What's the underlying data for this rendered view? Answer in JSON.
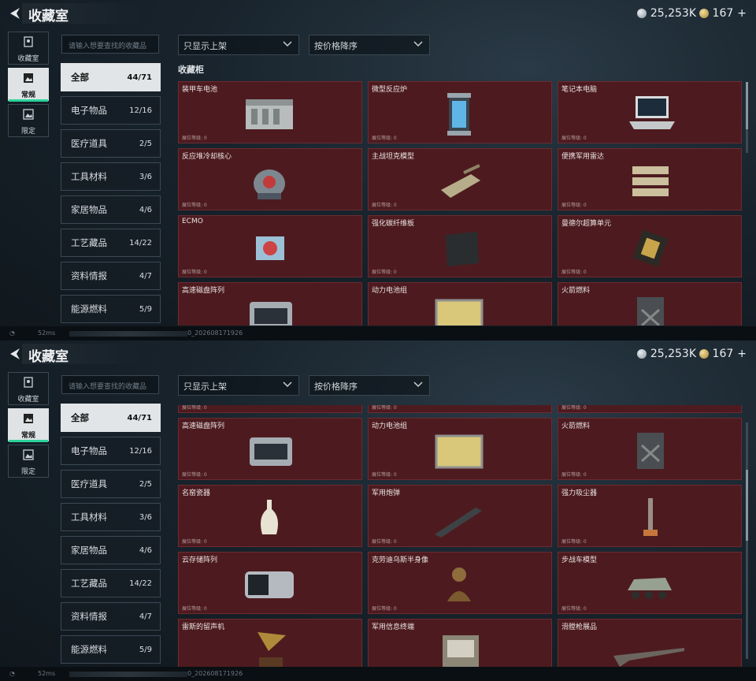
{
  "header": {
    "title": "收藏室",
    "currency1": "25,253K",
    "currency2": "167",
    "plus": "+"
  },
  "nav": [
    {
      "label": "收藏室",
      "icon": "portrait-icon"
    },
    {
      "label": "常规",
      "icon": "image-icon"
    },
    {
      "label": "限定",
      "icon": "image-frame-icon"
    }
  ],
  "search": {
    "placeholder": "请输入想要查找的收藏品"
  },
  "filters": {
    "listing": "只显示上架",
    "sort": "按价格降序"
  },
  "categories": [
    {
      "label": "全部",
      "count": "44/71"
    },
    {
      "label": "电子物品",
      "count": "12/16"
    },
    {
      "label": "医疗道具",
      "count": "2/5"
    },
    {
      "label": "工具材料",
      "count": "3/6"
    },
    {
      "label": "家居物品",
      "count": "4/6"
    },
    {
      "label": "工艺藏品",
      "count": "14/22"
    },
    {
      "label": "资料情报",
      "count": "4/7"
    },
    {
      "label": "能源燃料",
      "count": "5/9"
    }
  ],
  "section_title": "收藏柜",
  "level_label": "展位等级: 0",
  "items_top": [
    {
      "name": "装甲车电池",
      "icon": "battery-icon"
    },
    {
      "name": "微型反应炉",
      "icon": "reactor-icon"
    },
    {
      "name": "笔记本电脑",
      "icon": "laptop-icon"
    },
    {
      "name": "反应堆冷却核心",
      "icon": "core-icon"
    },
    {
      "name": "主战坦克模型",
      "icon": "tank-icon"
    },
    {
      "name": "便携军用雷达",
      "icon": "radar-icon"
    },
    {
      "name": "ECMO",
      "icon": "ecmo-icon"
    },
    {
      "name": "强化碳纤维板",
      "icon": "carbon-plate-icon"
    },
    {
      "name": "曼德尔超算单元",
      "icon": "chip-icon"
    },
    {
      "name": "高速磁盘阵列",
      "icon": "disk-array-icon"
    },
    {
      "name": "动力电池组",
      "icon": "battery-pack-icon"
    },
    {
      "name": "火箭燃料",
      "icon": "fuel-can-icon"
    }
  ],
  "items_bottom": [
    {
      "name": "",
      "icon": ""
    },
    {
      "name": "",
      "icon": ""
    },
    {
      "name": "",
      "icon": ""
    },
    {
      "name": "高速磁盘阵列",
      "icon": "disk-array-icon"
    },
    {
      "name": "动力电池组",
      "icon": "battery-pack-icon"
    },
    {
      "name": "火箭燃料",
      "icon": "fuel-can-icon"
    },
    {
      "name": "名窑瓷器",
      "icon": "vase-icon"
    },
    {
      "name": "军用炮弹",
      "icon": "shell-icon"
    },
    {
      "name": "强力吸尘器",
      "icon": "vacuum-icon"
    },
    {
      "name": "云存储阵列",
      "icon": "storage-icon"
    },
    {
      "name": "克劳迪乌斯半身像",
      "icon": "bust-icon"
    },
    {
      "name": "步战车模型",
      "icon": "ifv-icon"
    },
    {
      "name": "雷斯的留声机",
      "icon": "gramophone-icon"
    },
    {
      "name": "军用信息终端",
      "icon": "terminal-icon"
    },
    {
      "name": "滑膛枪展品",
      "icon": "musket-icon"
    }
  ],
  "footer": {
    "ping": "52ms",
    "build": "0_202608171926"
  }
}
